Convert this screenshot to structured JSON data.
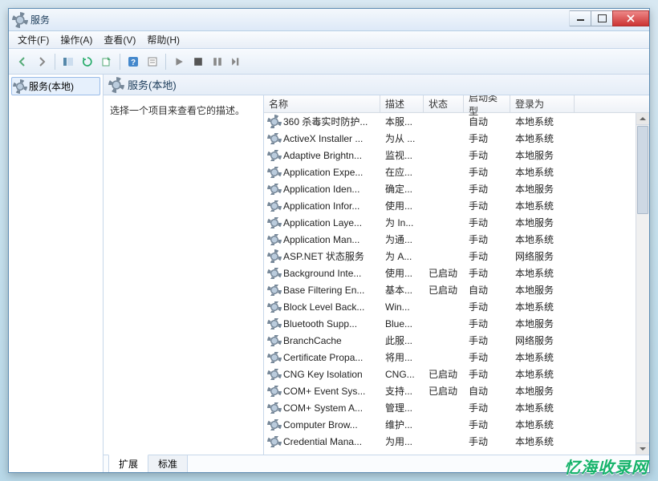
{
  "window": {
    "title": "服务"
  },
  "menu": {
    "file": "文件(F)",
    "action": "操作(A)",
    "view": "查看(V)",
    "help": "帮助(H)"
  },
  "nav": {
    "local": "服务(本地)"
  },
  "main": {
    "heading": "服务(本地)",
    "desc": "选择一个项目来查看它的描述。"
  },
  "columns": {
    "name": "名称",
    "desc": "描述",
    "status": "状态",
    "startup": "启动类型",
    "logon": "登录为"
  },
  "tabs": {
    "extended": "扩展",
    "standard": "标准"
  },
  "services": [
    {
      "name": "360 杀毒实时防护...",
      "desc": "本服...",
      "status": "",
      "startup": "自动",
      "logon": "本地系统"
    },
    {
      "name": "ActiveX Installer ...",
      "desc": "为从 ...",
      "status": "",
      "startup": "手动",
      "logon": "本地系统"
    },
    {
      "name": "Adaptive Brightn...",
      "desc": "监视...",
      "status": "",
      "startup": "手动",
      "logon": "本地服务"
    },
    {
      "name": "Application Expe...",
      "desc": "在应...",
      "status": "",
      "startup": "手动",
      "logon": "本地系统"
    },
    {
      "name": "Application Iden...",
      "desc": "确定...",
      "status": "",
      "startup": "手动",
      "logon": "本地服务"
    },
    {
      "name": "Application Infor...",
      "desc": "使用...",
      "status": "",
      "startup": "手动",
      "logon": "本地系统"
    },
    {
      "name": "Application Laye...",
      "desc": "为 In...",
      "status": "",
      "startup": "手动",
      "logon": "本地服务"
    },
    {
      "name": "Application Man...",
      "desc": "为通...",
      "status": "",
      "startup": "手动",
      "logon": "本地系统"
    },
    {
      "name": "ASP.NET 状态服务",
      "desc": "为 A...",
      "status": "",
      "startup": "手动",
      "logon": "网络服务"
    },
    {
      "name": "Background Inte...",
      "desc": "使用...",
      "status": "已启动",
      "startup": "手动",
      "logon": "本地系统"
    },
    {
      "name": "Base Filtering En...",
      "desc": "基本...",
      "status": "已启动",
      "startup": "自动",
      "logon": "本地服务"
    },
    {
      "name": "Block Level Back...",
      "desc": "Win...",
      "status": "",
      "startup": "手动",
      "logon": "本地系统"
    },
    {
      "name": "Bluetooth Supp...",
      "desc": "Blue...",
      "status": "",
      "startup": "手动",
      "logon": "本地服务"
    },
    {
      "name": "BranchCache",
      "desc": "此服...",
      "status": "",
      "startup": "手动",
      "logon": "网络服务"
    },
    {
      "name": "Certificate Propa...",
      "desc": "将用...",
      "status": "",
      "startup": "手动",
      "logon": "本地系统"
    },
    {
      "name": "CNG Key Isolation",
      "desc": "CNG...",
      "status": "已启动",
      "startup": "手动",
      "logon": "本地系统"
    },
    {
      "name": "COM+ Event Sys...",
      "desc": "支持...",
      "status": "已启动",
      "startup": "自动",
      "logon": "本地服务"
    },
    {
      "name": "COM+ System A...",
      "desc": "管理...",
      "status": "",
      "startup": "手动",
      "logon": "本地系统"
    },
    {
      "name": "Computer Brow...",
      "desc": "维护...",
      "status": "",
      "startup": "手动",
      "logon": "本地系统"
    },
    {
      "name": "Credential Mana...",
      "desc": "为用...",
      "status": "",
      "startup": "手动",
      "logon": "本地系统"
    }
  ],
  "watermark": {
    "main": "忆海收录网",
    "sub": ""
  }
}
